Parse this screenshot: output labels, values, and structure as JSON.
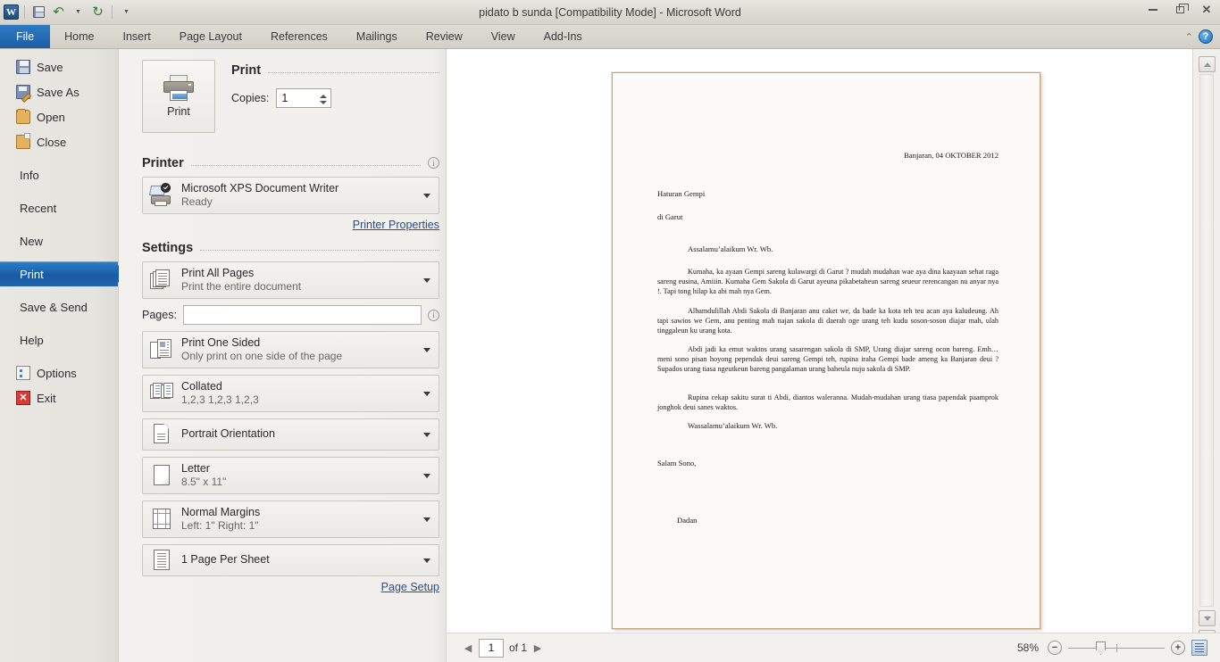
{
  "titlebar": {
    "app_icon": "word-logo",
    "document_title": "pidato b sunda [Compatibility Mode]  -  Microsoft Word",
    "quick_access": [
      {
        "name": "save-icon",
        "label": "Save"
      },
      {
        "name": "undo-icon",
        "label": "Undo",
        "glyph": "↶"
      },
      {
        "name": "redo-icon",
        "label": "Redo",
        "glyph": "↻"
      },
      {
        "name": "customize-qat-icon",
        "label": "Customize Quick Access Toolbar",
        "glyph": "⌄"
      }
    ],
    "window_controls": [
      {
        "name": "minimize-button",
        "glyph": "–"
      },
      {
        "name": "restore-button",
        "glyph": "❐"
      },
      {
        "name": "close-button",
        "glyph": "✕"
      }
    ]
  },
  "ribbon": {
    "tabs": [
      {
        "label": "File",
        "selected": true
      },
      {
        "label": "Home",
        "selected": false
      },
      {
        "label": "Insert",
        "selected": false
      },
      {
        "label": "Page Layout",
        "selected": false
      },
      {
        "label": "References",
        "selected": false
      },
      {
        "label": "Mailings",
        "selected": false
      },
      {
        "label": "Review",
        "selected": false
      },
      {
        "label": "View",
        "selected": false
      },
      {
        "label": "Add-Ins",
        "selected": false
      }
    ],
    "collapse_glyph": "⌃",
    "help_glyph": "?"
  },
  "backstage": {
    "items": [
      {
        "label": "Save",
        "icon": "save-icon",
        "selected": false
      },
      {
        "label": "Save As",
        "icon": "save-as-icon",
        "selected": false
      },
      {
        "label": "Open",
        "icon": "open-folder-icon",
        "selected": false
      },
      {
        "label": "Close",
        "icon": "close-folder-icon",
        "selected": false
      },
      {
        "label": "Info",
        "icon": null,
        "selected": false
      },
      {
        "label": "Recent",
        "icon": null,
        "selected": false
      },
      {
        "label": "New",
        "icon": null,
        "selected": false
      },
      {
        "label": "Print",
        "icon": null,
        "selected": true
      },
      {
        "label": "Save & Send",
        "icon": null,
        "selected": false
      },
      {
        "label": "Help",
        "icon": null,
        "selected": false
      },
      {
        "label": "Options",
        "icon": "options-icon",
        "selected": false
      },
      {
        "label": "Exit",
        "icon": "exit-icon",
        "selected": false
      }
    ]
  },
  "print_panel": {
    "print_button_label": "Print",
    "section_print_title": "Print",
    "copies_label": "Copies:",
    "copies_value": "1",
    "section_printer_title": "Printer",
    "printer_name": "Microsoft XPS Document Writer",
    "printer_status": "Ready",
    "printer_properties_link": "Printer Properties",
    "section_settings_title": "Settings",
    "settings": [
      {
        "name": "print-range",
        "title": "Print All Pages",
        "subtitle": "Print the entire document",
        "icon": "pages-stack-icon"
      },
      {
        "name": "print-sided",
        "title": "Print One Sided",
        "subtitle": "Only print on one side of the page",
        "icon": "one-sided-icon"
      },
      {
        "name": "collation",
        "title": "Collated",
        "subtitle": "1,2,3   1,2,3   1,2,3",
        "icon": "collate-icon"
      },
      {
        "name": "orientation",
        "title": "Portrait Orientation",
        "subtitle": "",
        "icon": "portrait-icon"
      },
      {
        "name": "paper-size",
        "title": "Letter",
        "subtitle": "8.5\" x 11\"",
        "icon": "paper-size-icon"
      },
      {
        "name": "margins",
        "title": "Normal Margins",
        "subtitle": "Left:  1\"   Right:  1\"",
        "icon": "margins-icon"
      },
      {
        "name": "pages-per-sheet",
        "title": "1 Page Per Sheet",
        "subtitle": "",
        "icon": "pages-per-sheet-icon"
      }
    ],
    "pages_label": "Pages:",
    "pages_value": "",
    "pages_placeholder": "",
    "page_setup_link": "Page Setup"
  },
  "preview": {
    "document": {
      "date_line": "Banjaran, 04 OKTOBER 2012",
      "recipient_1": "Haturan  Gempi",
      "recipient_2": "di Garut",
      "greeting": "Assalamu’alaikum Wr. Wb.",
      "paragraph_1": "Kumaha, ka ayaan Gempi sareng kulawargi di Garut ? mudah mudahan wae aya dina kaayaan sehat raga sareng eusina, Amiiin. Kumaha Gem Sakola di Garut ayeuna pikabetaheun sareng seueur rerencangan nu anyar nya !.  Tapi tong hilap ka abi mah nya Gem.",
      "paragraph_2": "Alhamdulillah Abdi Sakola di Banjaran anu caket we, da bade ka kota teh teu acan aya kaludeung. Ah tapi sawios we Gem, anu penting mah najan sakola di daerah oge urang teh kudu soson-soson diajar mah, ulah tinggaleun ku urang kota.",
      "paragraph_3": "Abdi jadi ka emut waktos urang sasarengan sakola di SMP, Urang diajar sareng ocon bareng. Emh… meni sono pisan hoyong pependak deui sareng Gempi teh, rupina iraha Gempi bade ameng ka Banjaran deui ? Supados urang tiasa ngeutkeun bareng pangalaman urang baheula nuju sakola di SMP.",
      "paragraph_4": "Rupina cekap sakitu surat ti Abdi, diantos waleranna. Mudah-mudahan urang tiasa papendak paamprok jonghok deui sanes waktos.",
      "closing": "Wassalamu’alaikum Wr. Wb.",
      "signoff": "Salam Sono,",
      "signature": "Dadan"
    },
    "scrollbar": {
      "up_arrow": "scroll-up-icon",
      "down_arrow": "scroll-down-icon"
    }
  },
  "statusbar": {
    "prev_page_glyph": "◀",
    "next_page_glyph": "▶",
    "current_page": "1",
    "page_count_label": "of 1",
    "zoom_percent": "58%",
    "zoom_out_glyph": "−",
    "zoom_in_glyph": "+",
    "zoom_to_page_icon": "zoom-to-page-icon"
  },
  "colors": {
    "accent_blue": "#1a5ba5",
    "file_tab_blue": "#2e7cc4",
    "panel_bg": "#f3f1ee",
    "page_border": "#c9a77a",
    "link_blue": "#2a4d8f"
  }
}
